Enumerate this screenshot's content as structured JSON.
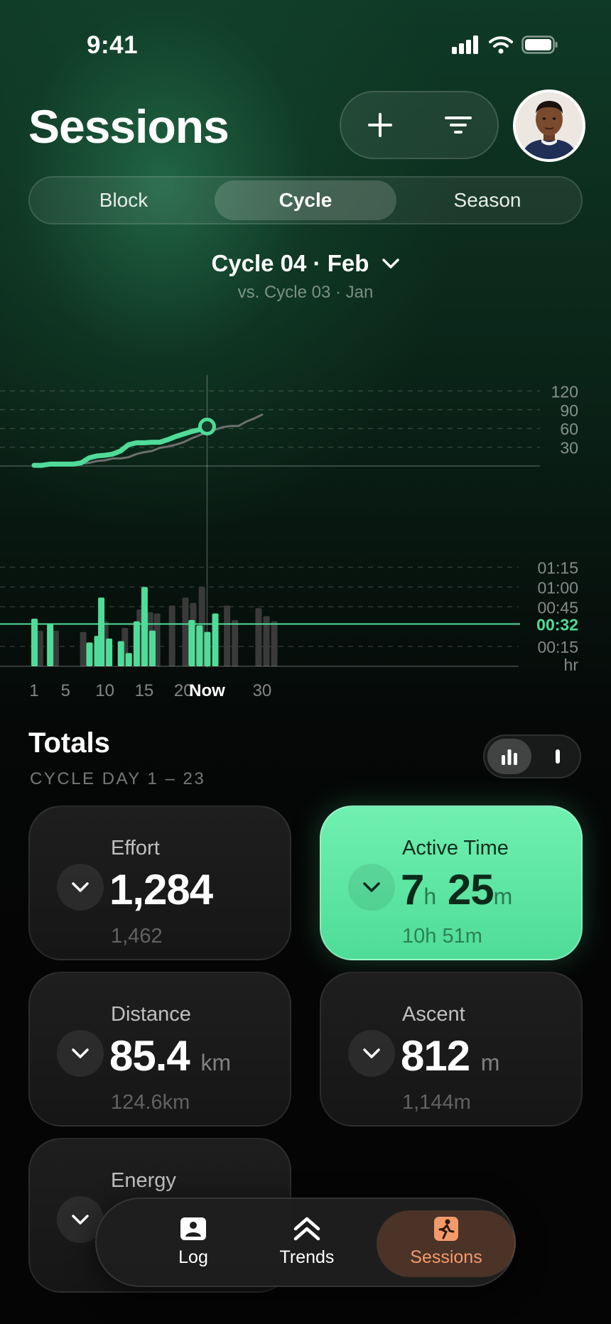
{
  "status_bar": {
    "time": "9:41"
  },
  "header": {
    "title": "Sessions"
  },
  "segments": [
    {
      "label": "Block",
      "active": false
    },
    {
      "label": "Cycle",
      "active": true
    },
    {
      "label": "Season",
      "active": false
    }
  ],
  "period": {
    "label": "Cycle 04 · Feb",
    "comparison": "vs. Cycle 03 · Jan"
  },
  "chart_data": [
    {
      "type": "line",
      "series": [
        {
          "name": "Cycle 04 · Feb",
          "color": "#4fdc98",
          "x": [
            1,
            2,
            3,
            4,
            5,
            6,
            7,
            8,
            9,
            10,
            11,
            12,
            13,
            14,
            15,
            16,
            17,
            18,
            19,
            20,
            21,
            22,
            23
          ],
          "values": [
            1,
            1,
            3,
            3,
            3,
            3,
            5,
            13,
            16,
            17,
            19,
            24,
            34,
            37,
            37,
            38,
            38,
            42,
            47,
            51,
            55,
            58,
            63
          ]
        },
        {
          "name": "Cycle 03 · Jan",
          "color": "#6f6f6f",
          "x": [
            1,
            2,
            3,
            4,
            5,
            6,
            7,
            8,
            9,
            10,
            11,
            12,
            13,
            14,
            15,
            16,
            17,
            18,
            19,
            20,
            21,
            22,
            23,
            24,
            25,
            26,
            27,
            28,
            29,
            30
          ],
          "values": [
            -1,
            -1,
            2,
            2,
            2,
            3,
            4,
            5,
            8,
            9,
            12,
            12,
            14,
            19,
            22,
            24,
            29,
            31,
            34,
            38,
            44,
            49,
            54,
            58,
            62,
            64,
            64,
            71,
            76,
            82
          ]
        }
      ],
      "y_ticks": [
        "120",
        "90",
        "60",
        "30"
      ],
      "now_x": 23,
      "xlim": [
        0,
        33
      ],
      "ylim": [
        -3,
        124
      ]
    },
    {
      "type": "bar",
      "ylabel": "hr",
      "y_ticks": [
        "01:15",
        "01:00",
        "00:45",
        "00:15"
      ],
      "average_label": "00:32",
      "average_minutes": 32,
      "x_ticks": [
        "1",
        "5",
        "10",
        "15",
        "20",
        "Now",
        "30"
      ],
      "x_tick_positions": [
        1,
        5,
        10,
        15,
        20,
        23,
        30
      ],
      "series": [
        {
          "name": "Cycle 04 · Feb",
          "color": "#4fdc98",
          "bars": [
            [
              1,
              36
            ],
            [
              3,
              32
            ],
            [
              8,
              18
            ],
            [
              9,
              23
            ],
            [
              9.5,
              52
            ],
            [
              10.5,
              21
            ],
            [
              12,
              19
            ],
            [
              13,
              10
            ],
            [
              14,
              34
            ],
            [
              15,
              60
            ],
            [
              16,
              27
            ],
            [
              21,
              35
            ],
            [
              22,
              31
            ],
            [
              23,
              26
            ],
            [
              24,
              40
            ]
          ]
        },
        {
          "name": "Cycle 03 · Jan",
          "color": "#3a3a3a",
          "bars": [
            [
              1.7,
              27
            ],
            [
              3.7,
              27
            ],
            [
              7.2,
              26
            ],
            [
              10,
              34
            ],
            [
              12.5,
              29
            ],
            [
              14.4,
              43
            ],
            [
              15.7,
              41
            ],
            [
              16.6,
              40
            ],
            [
              18.5,
              46
            ],
            [
              20.2,
              52
            ],
            [
              21.2,
              48
            ],
            [
              22.3,
              60
            ],
            [
              25.5,
              46
            ],
            [
              26.5,
              35
            ],
            [
              29.5,
              44
            ],
            [
              30.5,
              38
            ],
            [
              31.5,
              34
            ]
          ]
        }
      ],
      "xlim": [
        -1,
        33
      ],
      "ylim": [
        0,
        80
      ]
    }
  ],
  "totals": {
    "title": "Totals",
    "subtitle": "CYCLE DAY 1 – 23",
    "cards": [
      {
        "label": "Effort",
        "value": "1,284",
        "unit": "",
        "previous": "1,462"
      },
      {
        "label": "Active Time",
        "h_value": "7",
        "h_unit": "h",
        "m_value": "25",
        "m_unit": "m",
        "previous": "10h 51m"
      },
      {
        "label": "Distance",
        "value": "85.4",
        "unit": "km",
        "previous": "124.6km"
      },
      {
        "label": "Ascent",
        "value": "812",
        "unit": "m",
        "previous": "1,144m"
      },
      {
        "label": "Energy"
      }
    ]
  },
  "tabbar": [
    {
      "label": "Log",
      "icon": "log-icon"
    },
    {
      "label": "Trends",
      "icon": "trends-icon"
    },
    {
      "label": "Sessions",
      "icon": "sessions-icon",
      "active": true
    }
  ],
  "colors": {
    "accent": "#4fdc98",
    "active_tab": "#f49a6a"
  }
}
